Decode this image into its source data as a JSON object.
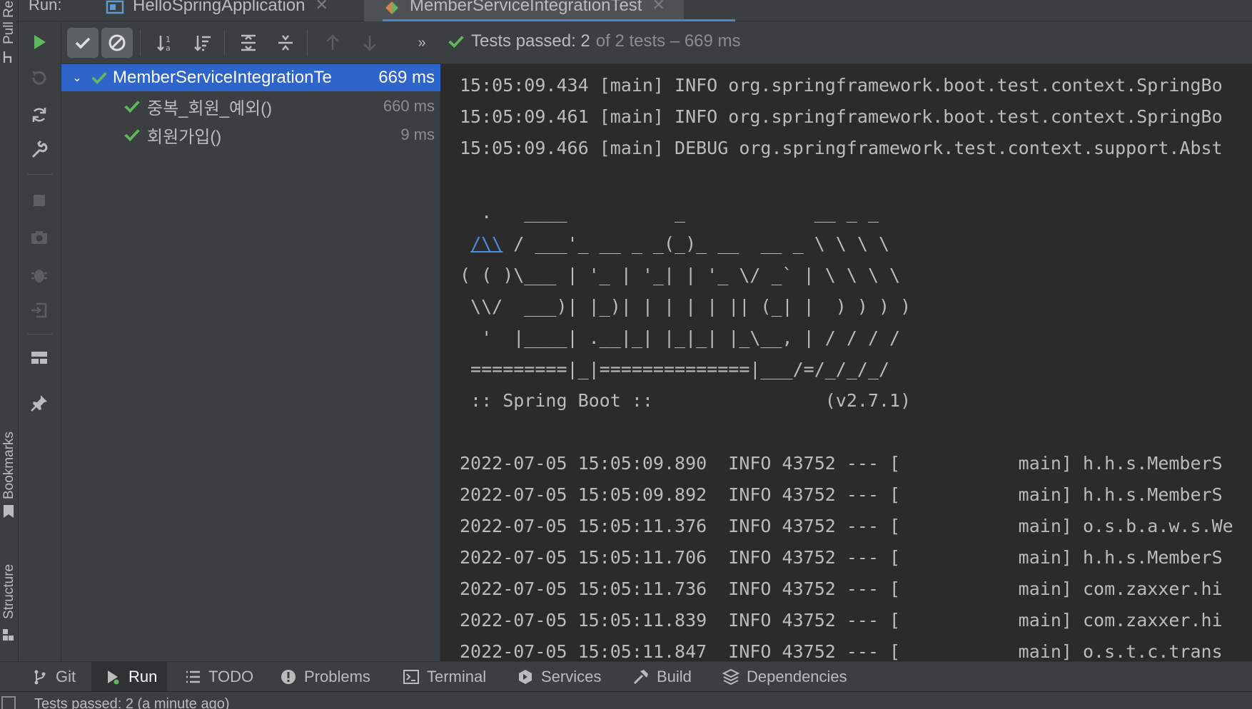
{
  "window": {
    "run_label": "Run:",
    "tabs": [
      {
        "label": "HelloSpringApplication",
        "active": false
      },
      {
        "label": "MemberServiceIntegrationTest",
        "active": true
      }
    ]
  },
  "left_strip": {
    "items": [
      "Pull Requests",
      "Bookmarks",
      "Structure"
    ]
  },
  "toolbar": {
    "status_passed": "Tests passed: 2",
    "status_total": "of 2 tests – 669 ms"
  },
  "tree": {
    "root": {
      "name": "MemberServiceIntegrationTe",
      "duration": "669 ms"
    },
    "children": [
      {
        "name": "중복_회원_예외()",
        "duration": "660 ms"
      },
      {
        "name": "회원가입()",
        "duration": "9 ms"
      }
    ]
  },
  "console": {
    "lines_top": [
      "15:05:09.434 [main] INFO org.springframework.boot.test.context.SpringBo",
      "15:05:09.461 [main] INFO org.springframework.boot.test.context.SpringBo",
      "15:05:09.466 [main] DEBUG org.springframework.test.context.support.Abst"
    ],
    "banner": {
      "l1": "  .   ____          _            __ _ _",
      "l2_pre": " ",
      "l2_blue": "/\\\\",
      "l2_post": " / ___'_ __ _ _(_)_ __  __ _ \\ \\ \\ \\",
      "l3": "( ( )\\___ | '_ | '_| | '_ \\/ _` | \\ \\ \\ \\",
      "l4": " \\\\/  ___)| |_)| | | | | || (_| |  ) ) ) )",
      "l5": "  '  |____| .__|_| |_|_| |_\\__, | / / / /",
      "l6": " =========|_|==============|___/=/_/_/_/",
      "l7": " :: Spring Boot ::                (v2.7.1)"
    },
    "log_lines": [
      "2022-07-05 15:05:09.890  INFO 43752 --- [           main] h.h.s.MemberS",
      "2022-07-05 15:05:09.892  INFO 43752 --- [           main] h.h.s.MemberS",
      "2022-07-05 15:05:11.376  INFO 43752 --- [           main] o.s.b.a.w.s.We",
      "2022-07-05 15:05:11.706  INFO 43752 --- [           main] h.h.s.MemberS",
      "2022-07-05 15:05:11.736  INFO 43752 --- [           main] com.zaxxer.hi",
      "2022-07-05 15:05:11.839  INFO 43752 --- [           main] com.zaxxer.hi",
      "2022-07-05 15:05:11.847  INFO 43752 --- [           main] o.s.t.c.trans"
    ]
  },
  "bottom_bar": {
    "tabs": [
      {
        "label": "Git",
        "icon": "git-branch-icon"
      },
      {
        "label": "Run",
        "icon": "run-icon",
        "active": true
      },
      {
        "label": "TODO",
        "icon": "list-icon"
      },
      {
        "label": "Problems",
        "icon": "problems-icon"
      },
      {
        "label": "Terminal",
        "icon": "terminal-icon"
      },
      {
        "label": "Services",
        "icon": "services-icon"
      },
      {
        "label": "Build",
        "icon": "hammer-icon"
      },
      {
        "label": "Dependencies",
        "icon": "layers-icon"
      }
    ]
  },
  "status_bar": {
    "text": "Tests passed: 2 (a minute ago)"
  },
  "colors": {
    "accent": "#2f65ca",
    "pass_green": "#5fb85b",
    "banner_blue": "#4a8fe0"
  }
}
